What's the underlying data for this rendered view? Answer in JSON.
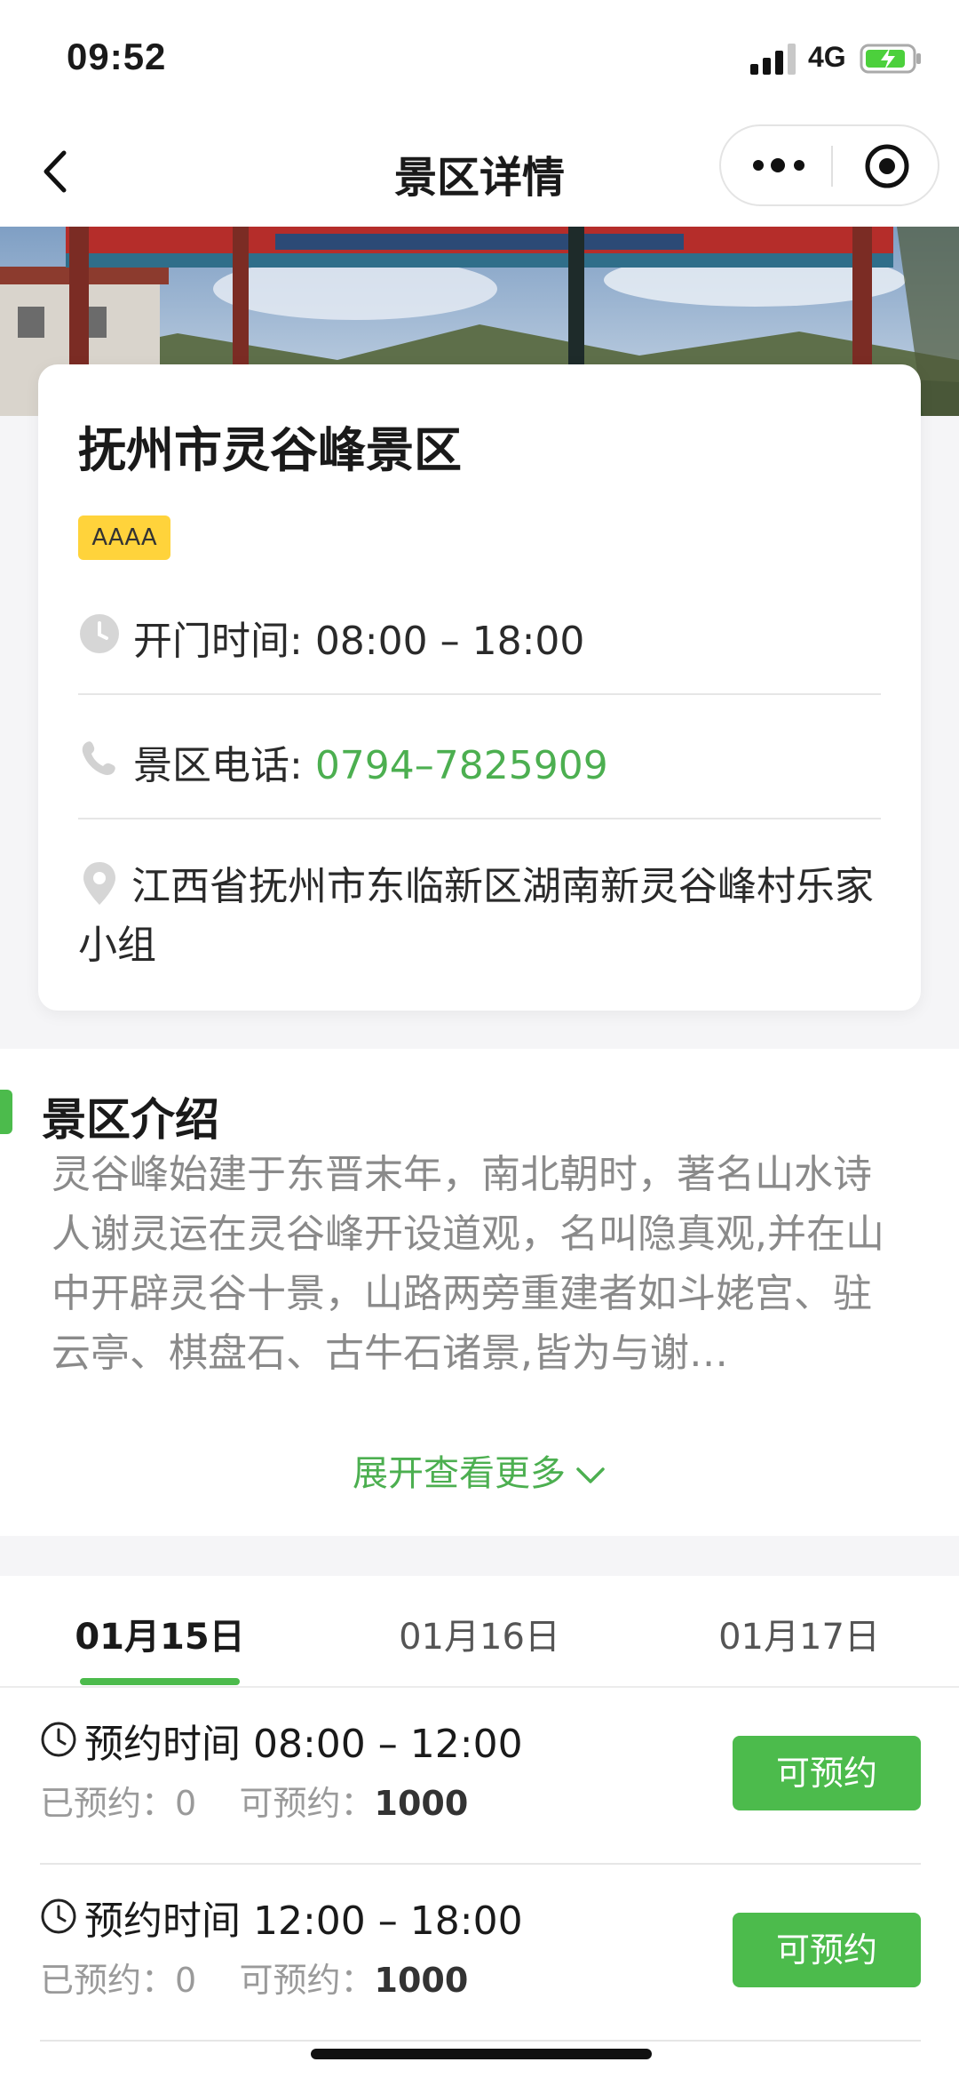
{
  "status_bar": {
    "time": "09:52",
    "network": "4G"
  },
  "nav": {
    "title": "景区详情"
  },
  "scenic": {
    "name": "抚州市灵谷峰景区",
    "rating_badge": "AAAA",
    "hours_label": "开门时间: ",
    "hours_value": "08:00 – 18:00",
    "phone_label": "景区电话: ",
    "phone_value": "0794–7825909",
    "address": "江西省抚州市东临新区湖南新灵谷峰村乐家小组"
  },
  "intro": {
    "title": "景区介绍",
    "text": "灵谷峰始建于东晋末年，南北朝时，著名山水诗人谢灵运在灵谷峰开设道观，名叫隐真观,并在山中开辟灵谷十景，山路两旁重建者如斗姥宫、驻云亭、棋盘石、古牛石诸景,皆为与谢…",
    "expand_label": "展开查看更多"
  },
  "schedule": {
    "tabs": [
      "01月15日",
      "01月16日",
      "01月17日"
    ],
    "active_tab": 0,
    "slots": [
      {
        "time": "预约时间 08:00 – 12:00",
        "booked_label": "已预约：",
        "booked": "0",
        "available_label": "可预约：",
        "available": "1000",
        "button": "可预约"
      },
      {
        "time": "预约时间 12:00 – 18:00",
        "booked_label": "已预约：",
        "booked": "0",
        "available_label": "可预约：",
        "available": "1000",
        "button": "可预约"
      }
    ]
  },
  "colors": {
    "accent": "#4cbb4c",
    "badge": "#ffd33b",
    "phone": "#4caf50"
  }
}
